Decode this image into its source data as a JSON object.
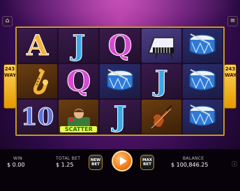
{
  "badge": {
    "number": "243",
    "word": "WAYS"
  },
  "symbols": {
    "a": "A",
    "j": "J",
    "q": "Q",
    "ten": "10",
    "scatter": "SCATTER"
  },
  "hud": {
    "win_label": "WIN",
    "win_value": "$ 0.00",
    "total_bet_label": "TOTAL BET",
    "total_bet_value": "$ 1.25",
    "balance_label": "BALANCE",
    "balance_value": "$ 100,846.25"
  },
  "buttons": {
    "new_bet": "NEW BET",
    "max_bet": "MAX BET"
  },
  "icons": {
    "home": "home-icon",
    "menu": "hamburger-menu-icon",
    "info": "info-icon"
  },
  "colors": {
    "accent": "#f07b1a",
    "frame": "#c79a20"
  }
}
